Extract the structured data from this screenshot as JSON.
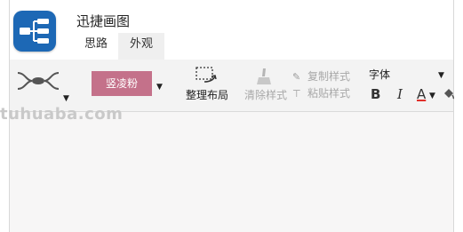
{
  "app": {
    "title": "迅捷画图"
  },
  "tabs": [
    {
      "label": "思路",
      "active": true
    },
    {
      "label": "外观",
      "active": false
    }
  ],
  "toolbar": {
    "theme_color_label": "竖凌粉",
    "theme_color": "#c4718a",
    "layout_label": "整理布局",
    "clear_style_label": "清除样式",
    "copy_style_label": "复制样式",
    "paste_style_label": "粘贴样式",
    "font_label": "字体",
    "bold_label": "B",
    "italic_label": "I",
    "font_color_label": "A",
    "font_color_accent": "#e0312b"
  },
  "watermark": {
    "text": "tuhuaba.com"
  },
  "icons": {
    "logo": "mindmap-logo-icon",
    "theme": "mindmap-structure-icon",
    "layout": "layout-arrange-icon",
    "clear": "eraser-icon",
    "copy": "copy-style-icon",
    "paste": "paste-style-icon",
    "paint": "paint-bucket-icon"
  }
}
